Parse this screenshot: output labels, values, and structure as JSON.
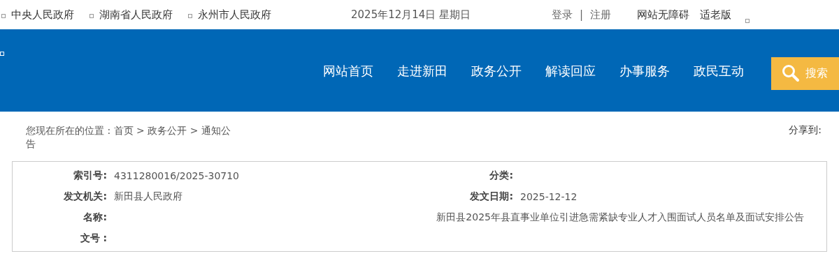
{
  "top_bar": {
    "gov_links": [
      {
        "label": "中央人民政府"
      },
      {
        "label": "湖南省人民政府"
      },
      {
        "label": "永州市人民政府"
      }
    ],
    "date": "2025年12月14日 星期日",
    "login": "登录",
    "separator": "|",
    "register": "注册",
    "accessibility": "网站无障碍",
    "elder_mode": "适老版"
  },
  "nav": {
    "items": [
      {
        "label": "网站首页"
      },
      {
        "label": "走进新田"
      },
      {
        "label": "政务公开"
      },
      {
        "label": "解读回应"
      },
      {
        "label": "办事服务"
      },
      {
        "label": "政民互动"
      }
    ],
    "search_button": "搜索"
  },
  "breadcrumb": "您现在所在的位置 : 首页 > 政务公开 > 通知公告",
  "share_label": "分享到:",
  "info": {
    "index_label": "索引号:",
    "index_value": "4311280016/2025-30710",
    "category_label": "分类:",
    "issuer_label": "发文机关:",
    "issuer_value": "新田县人民政府",
    "date_label": "发文日期:",
    "date_value": "2025-12-12",
    "name_label": "名称:",
    "name_value": "新田县2025年县直事业单位引进急需紧缺专业人才入围面试人员名单及面试安排公告",
    "doc_no_label": "文号 :"
  }
}
